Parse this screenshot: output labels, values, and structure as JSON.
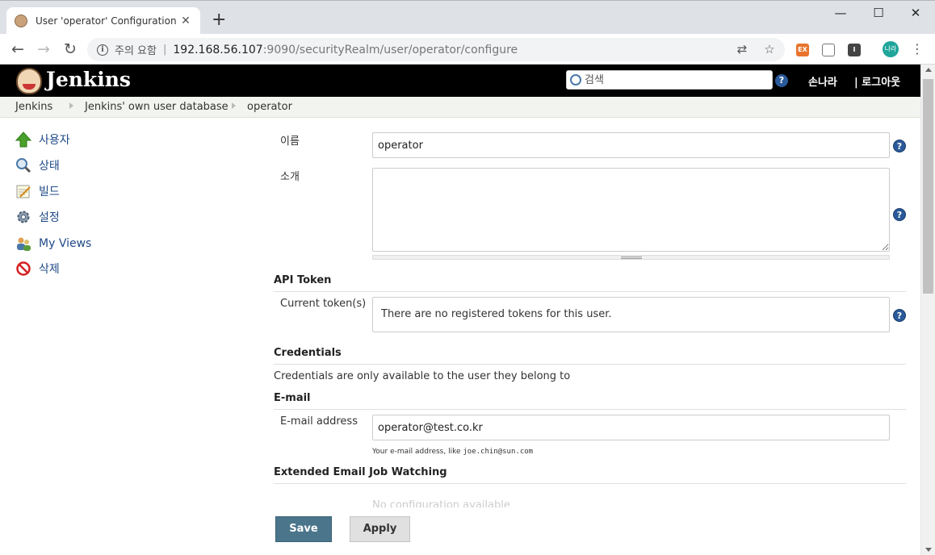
{
  "browser": {
    "tab_title": "User 'operator' Configuration [Je",
    "tab_close": "✕",
    "new_tab": "+",
    "minimize": "—",
    "maximize": "☐",
    "close": "✕",
    "back": "←",
    "forward": "→",
    "reload": "↻",
    "security_label": "주의 요함",
    "separator": "|",
    "url_host": "192.168.56.107",
    "url_path": ":9090/securityRealm/user/operator/configure",
    "profile_label": "나라"
  },
  "jenkins": {
    "logo_text": "Jenkins",
    "search_placeholder": "검색",
    "user_name": "손나라",
    "logout_label": "| 로그아웃"
  },
  "breadcrumbs": [
    "Jenkins",
    "Jenkins' own user database",
    "operator"
  ],
  "sidebar": {
    "items": [
      {
        "label": "사용자",
        "icon": "up-arrow-icon"
      },
      {
        "label": "상태",
        "icon": "magnifier-icon"
      },
      {
        "label": "빌드",
        "icon": "notepad-icon"
      },
      {
        "label": "설정",
        "icon": "gear-icon"
      },
      {
        "label": "My Views",
        "icon": "users-icon"
      },
      {
        "label": "삭제",
        "icon": "no-entry-icon"
      }
    ]
  },
  "form": {
    "name_label": "이름",
    "name_value": "operator",
    "description_label": "소개",
    "description_value": "",
    "api_token_section": "API Token",
    "current_tokens_label": "Current token(s)",
    "no_tokens_text": "There are no registered tokens for this user.",
    "credentials_section": "Credentials",
    "credentials_text": "Credentials are only available to the user they belong to",
    "email_section": "E-mail",
    "email_label": "E-mail address",
    "email_value": "operator@test.co.kr",
    "email_hint_prefix": "Your e-mail address, like ",
    "email_hint_example": "joe.chin@sun.com",
    "extended_email_section": "Extended Email Job Watching",
    "no_configuration_text": "No configuration available",
    "help_glyph": "?"
  },
  "buttons": {
    "save": "Save",
    "apply": "Apply"
  },
  "colors": {
    "header_bg": "#000000",
    "breadcrumb_bg": "#f2f4ef",
    "save_button": "#4b758b",
    "link": "#204a87"
  }
}
